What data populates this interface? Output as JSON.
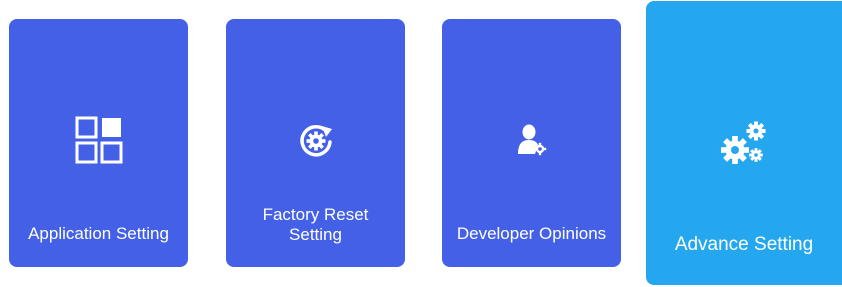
{
  "tiles": [
    {
      "label": "Application Setting",
      "icon": "grid-icon",
      "color": "#4460e6"
    },
    {
      "label": "Factory Reset\nSetting",
      "icon": "reset-icon",
      "color": "#4460e6"
    },
    {
      "label": "Developer Opinions",
      "icon": "developer-icon",
      "color": "#4460e6"
    },
    {
      "label": "Advance Setting",
      "icon": "gears-icon",
      "color": "#24a7ef",
      "selected": true
    }
  ]
}
